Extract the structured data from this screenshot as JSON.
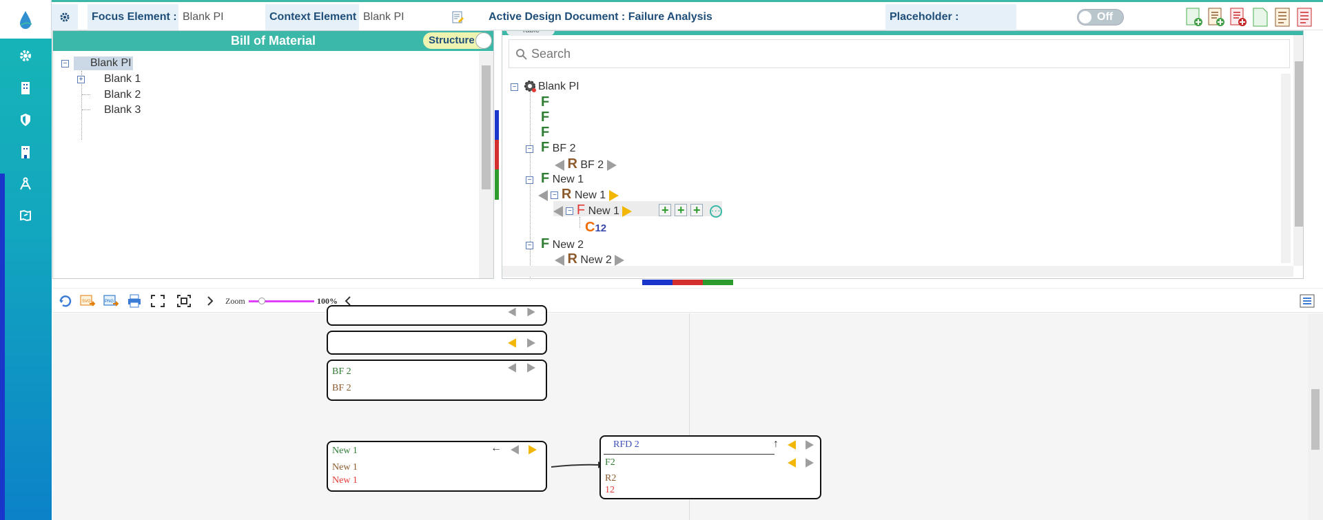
{
  "topbar": {
    "focus_label": "Focus Element :",
    "focus_value": "Blank PI",
    "context_label": "Context Element",
    "context_value": "Blank PI",
    "active_doc": "Active Design Document : Failure Analysis",
    "placeholder_label": "Placeholder :",
    "placeholder_toggle": "Off"
  },
  "bom": {
    "title": "Bill of Material",
    "toggle": "Structure",
    "root": "Blank PI",
    "items": [
      "Blank 1",
      "Blank 2",
      "Blank 3"
    ]
  },
  "right": {
    "search_placeholder": "Search",
    "tab_partial": "Table",
    "root": "Blank PI",
    "rows": {
      "bf2": "BF 2",
      "bf2_r": "BF 2",
      "new1": "New 1",
      "new1_r": "New 1",
      "new1_f": "New 1",
      "c12": "12",
      "new2": "New 2",
      "new2_r": "New 2"
    },
    "letters": {
      "F": "F",
      "R": "R",
      "C": "C"
    }
  },
  "toolbar2": {
    "zoom_label": "Zoom",
    "zoom_value": "100%"
  },
  "canvas": {
    "card2": {
      "l1": "BF 2",
      "l2": "BF 2"
    },
    "card3": {
      "l1": "New 1",
      "l2": "New 1",
      "l3": "New 1"
    },
    "card4": {
      "title": "RFD 2",
      "l1": "F2",
      "l2": "R2",
      "l3": "12"
    }
  },
  "colors": {
    "teal": "#3bb8a8",
    "sidebar_top": "#17b7b6",
    "sidebar_bottom": "#0c82c8",
    "function_green": "#2e7d32",
    "requirement_brown": "#8d5a2b",
    "failure_red": "#e53935",
    "cause_orange": "#ef6c00"
  }
}
